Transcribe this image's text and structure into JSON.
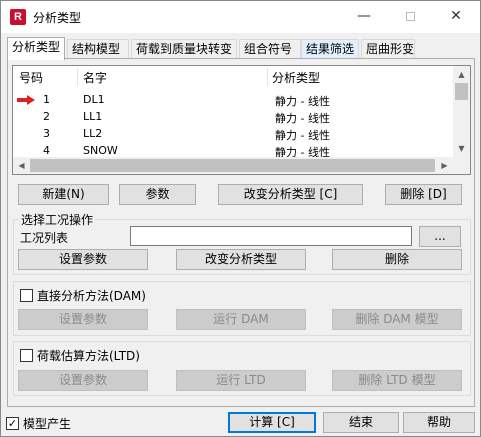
{
  "window": {
    "title": "分析类型",
    "app_icon_letter": "R",
    "minimize": "—",
    "close": "✕"
  },
  "tabs": [
    {
      "label": "分析类型"
    },
    {
      "label": "结构模型"
    },
    {
      "label": "荷载到质量块转变"
    },
    {
      "label": "组合符号"
    },
    {
      "label": "结果筛选"
    },
    {
      "label": "屈曲形变"
    }
  ],
  "case_list": {
    "headers": {
      "number": "号码",
      "name": "名字",
      "analysis_type": "分析类型"
    },
    "rows": [
      {
        "number": "1",
        "name": "DL1",
        "analysis_type": "静力 - 线性",
        "marked": true
      },
      {
        "number": "2",
        "name": "LL1",
        "analysis_type": "静力 - 线性",
        "marked": false
      },
      {
        "number": "3",
        "name": "LL2",
        "analysis_type": "静力 - 线性",
        "marked": false
      },
      {
        "number": "4",
        "name": "SNOW",
        "analysis_type": "静力 - 线性",
        "marked": false
      }
    ],
    "arrow_color": "#e02020"
  },
  "case_buttons": {
    "new": "新建(N)",
    "params": "参数",
    "change_type": "改变分析类型 [C]",
    "delete": "删除 [D]"
  },
  "case_ops": {
    "group_label": "选择工况操作",
    "list_label": "工况列表",
    "list_value": "",
    "browse": "...",
    "set_params": "设置参数",
    "change_type": "改变分析类型",
    "delete": "删除"
  },
  "dam": {
    "checkbox_label": "直接分析方法(DAM)",
    "checked": false,
    "set_params": "设置参数",
    "run": "运行 DAM",
    "delete_model": "删除 DAM 模型"
  },
  "ltd": {
    "checkbox_label": "荷载估算方法(LTD)",
    "checked": false,
    "set_params": "设置参数",
    "run": "运行 LTD",
    "delete_model": "删除 LTD 模型"
  },
  "footer": {
    "model_gen_label": "模型产生",
    "model_gen_checked": true,
    "calculate": "计算 [C]",
    "close": "结束",
    "help": "帮助"
  }
}
